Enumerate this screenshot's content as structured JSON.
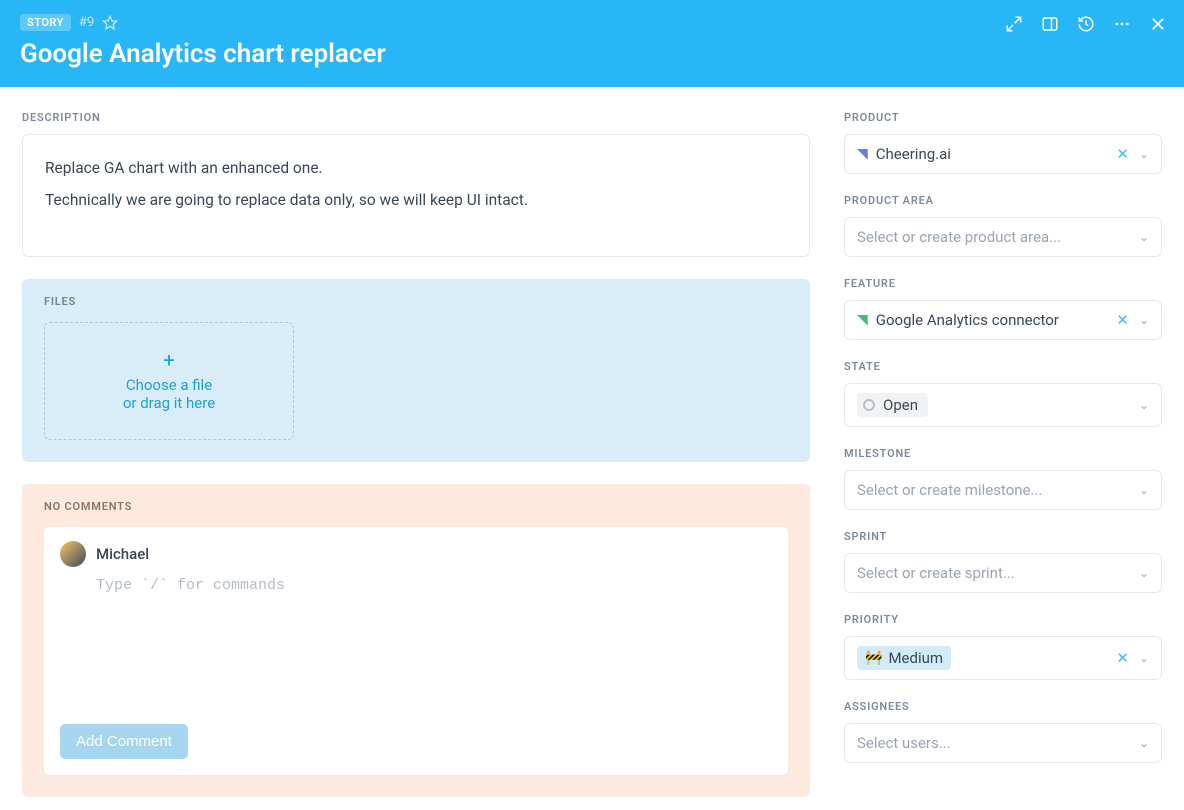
{
  "header": {
    "badge": "STORY",
    "id": "#9",
    "title": "Google Analytics chart replacer"
  },
  "description": {
    "label": "DESCRIPTION",
    "para1": "Replace GA chart with an enhanced one.",
    "para2": "Technically we are going to replace data only, so we will keep UI intact."
  },
  "files": {
    "label": "FILES",
    "choose_line1": "Choose a file",
    "choose_line2": "or drag it here"
  },
  "comments": {
    "label": "NO COMMENTS",
    "author": "Michael",
    "placeholder": "Type `/` for commands",
    "add_button": "Add Comment"
  },
  "sidebar": {
    "product": {
      "label": "PRODUCT",
      "value": "Cheering.ai"
    },
    "product_area": {
      "label": "PRODUCT AREA",
      "placeholder": "Select or create product area..."
    },
    "feature": {
      "label": "FEATURE",
      "value": "Google Analytics connector"
    },
    "state": {
      "label": "STATE",
      "value": "Open"
    },
    "milestone": {
      "label": "MILESTONE",
      "placeholder": "Select or create milestone..."
    },
    "sprint": {
      "label": "SPRINT",
      "placeholder": "Select or create sprint..."
    },
    "priority": {
      "label": "PRIORITY",
      "value": "Medium"
    },
    "assignees": {
      "label": "ASSIGNEES",
      "placeholder": "Select users..."
    }
  }
}
